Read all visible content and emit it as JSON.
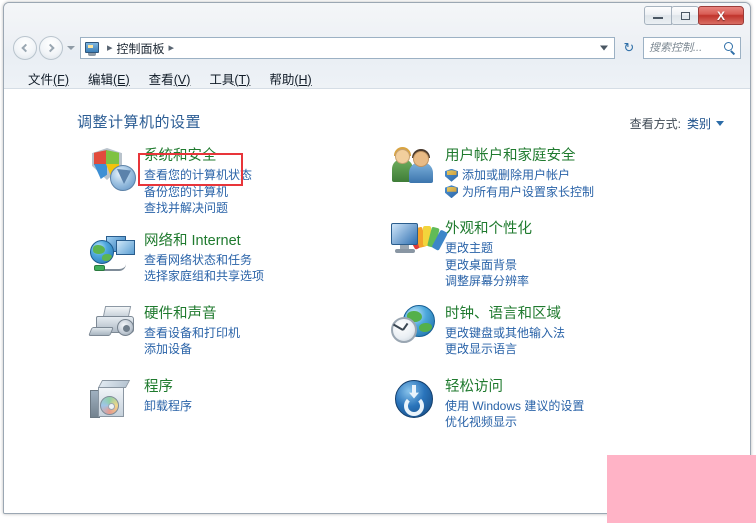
{
  "window": {
    "title": "",
    "minimize_label": "",
    "restore_label": "",
    "close_label": "X"
  },
  "navigation": {
    "back_label": "",
    "forward_label": "",
    "history_label": "",
    "address": {
      "icon": "control-panel-icon",
      "separator_1": "▸",
      "crumb": "控制面板",
      "separator_2": "▸"
    },
    "refresh_label": "↻",
    "search": {
      "value": "",
      "placeholder": "搜索控制..."
    }
  },
  "menubar": {
    "items": [
      {
        "text": "文件",
        "accel": "(F)"
      },
      {
        "text": "编辑",
        "accel": "(E)"
      },
      {
        "text": "查看",
        "accel": "(V)"
      },
      {
        "text": "工具",
        "accel": "(T)"
      },
      {
        "text": "帮助",
        "accel": "(H)"
      }
    ]
  },
  "content": {
    "page_title": "调整计算机的设置",
    "view_by": {
      "label": "查看方式:",
      "value": "类别"
    },
    "left_column": [
      {
        "icon": "shield-and-disc-icon",
        "title": "系统和安全",
        "highlighted": true,
        "links": [
          {
            "text": "查看您的计算机状态",
            "shield": false
          },
          {
            "text": "备份您的计算机",
            "shield": false
          },
          {
            "text": "查找并解决问题",
            "shield": false
          }
        ]
      },
      {
        "icon": "globe-and-monitors-icon",
        "title": "网络和 Internet",
        "highlighted": false,
        "links": [
          {
            "text": "查看网络状态和任务",
            "shield": false
          },
          {
            "text": "选择家庭组和共享选项",
            "shield": false
          }
        ]
      },
      {
        "icon": "printer-and-speaker-icon",
        "title": "硬件和声音",
        "highlighted": false,
        "links": [
          {
            "text": "查看设备和打印机",
            "shield": false
          },
          {
            "text": "添加设备",
            "shield": false
          }
        ]
      },
      {
        "icon": "software-box-icon",
        "title": "程序",
        "highlighted": false,
        "links": [
          {
            "text": "卸载程序",
            "shield": false
          }
        ]
      }
    ],
    "right_column": [
      {
        "icon": "users-icon",
        "title": "用户帐户和家庭安全",
        "highlighted": false,
        "links": [
          {
            "text": "添加或删除用户帐户",
            "shield": true
          },
          {
            "text": "为所有用户设置家长控制",
            "shield": true
          }
        ]
      },
      {
        "icon": "monitor-and-color-fan-icon",
        "title": "外观和个性化",
        "highlighted": false,
        "links": [
          {
            "text": "更改主题",
            "shield": false
          },
          {
            "text": "更改桌面背景",
            "shield": false
          },
          {
            "text": "调整屏幕分辨率",
            "shield": false
          }
        ]
      },
      {
        "icon": "clock-and-globe-icon",
        "title": "时钟、语言和区域",
        "highlighted": false,
        "links": [
          {
            "text": "更改键盘或其他输入法",
            "shield": false
          },
          {
            "text": "更改显示语言",
            "shield": false
          }
        ]
      },
      {
        "icon": "ease-of-access-icon",
        "title": "轻松访问",
        "highlighted": false,
        "links": [
          {
            "text": "使用 Windows 建议的设置",
            "shield": false
          },
          {
            "text": "优化视频显示",
            "shield": false
          }
        ]
      }
    ]
  },
  "annotations": {
    "highlight_rect": {
      "color": "#e8353a",
      "target": "系统和安全"
    },
    "redaction_block": {
      "color": "#ffb3c6"
    }
  }
}
